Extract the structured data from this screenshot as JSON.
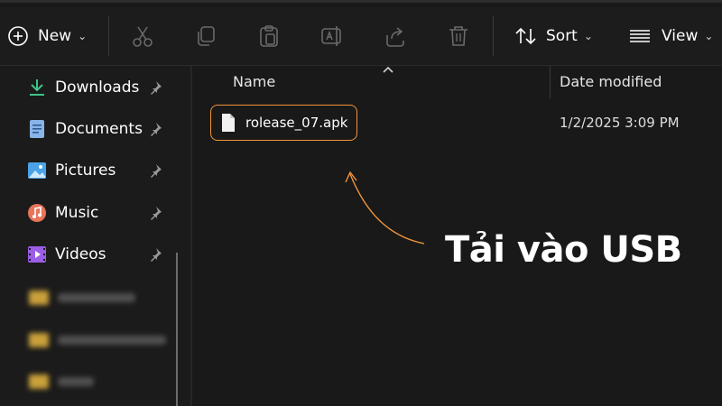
{
  "toolbar": {
    "new_label": "New",
    "sort_label": "Sort",
    "view_label": "View"
  },
  "sidebar": {
    "items": [
      {
        "label": "Downloads"
      },
      {
        "label": "Documents"
      },
      {
        "label": "Pictures"
      },
      {
        "label": "Music"
      },
      {
        "label": "Videos"
      }
    ]
  },
  "columns": {
    "name": "Name",
    "date_modified": "Date modified"
  },
  "files": [
    {
      "name": "rolease_07.apk",
      "date": "1/2/2025 3:09 PM"
    }
  ],
  "annotation": {
    "text": "Tải vào USB",
    "color": "#f0943a"
  }
}
